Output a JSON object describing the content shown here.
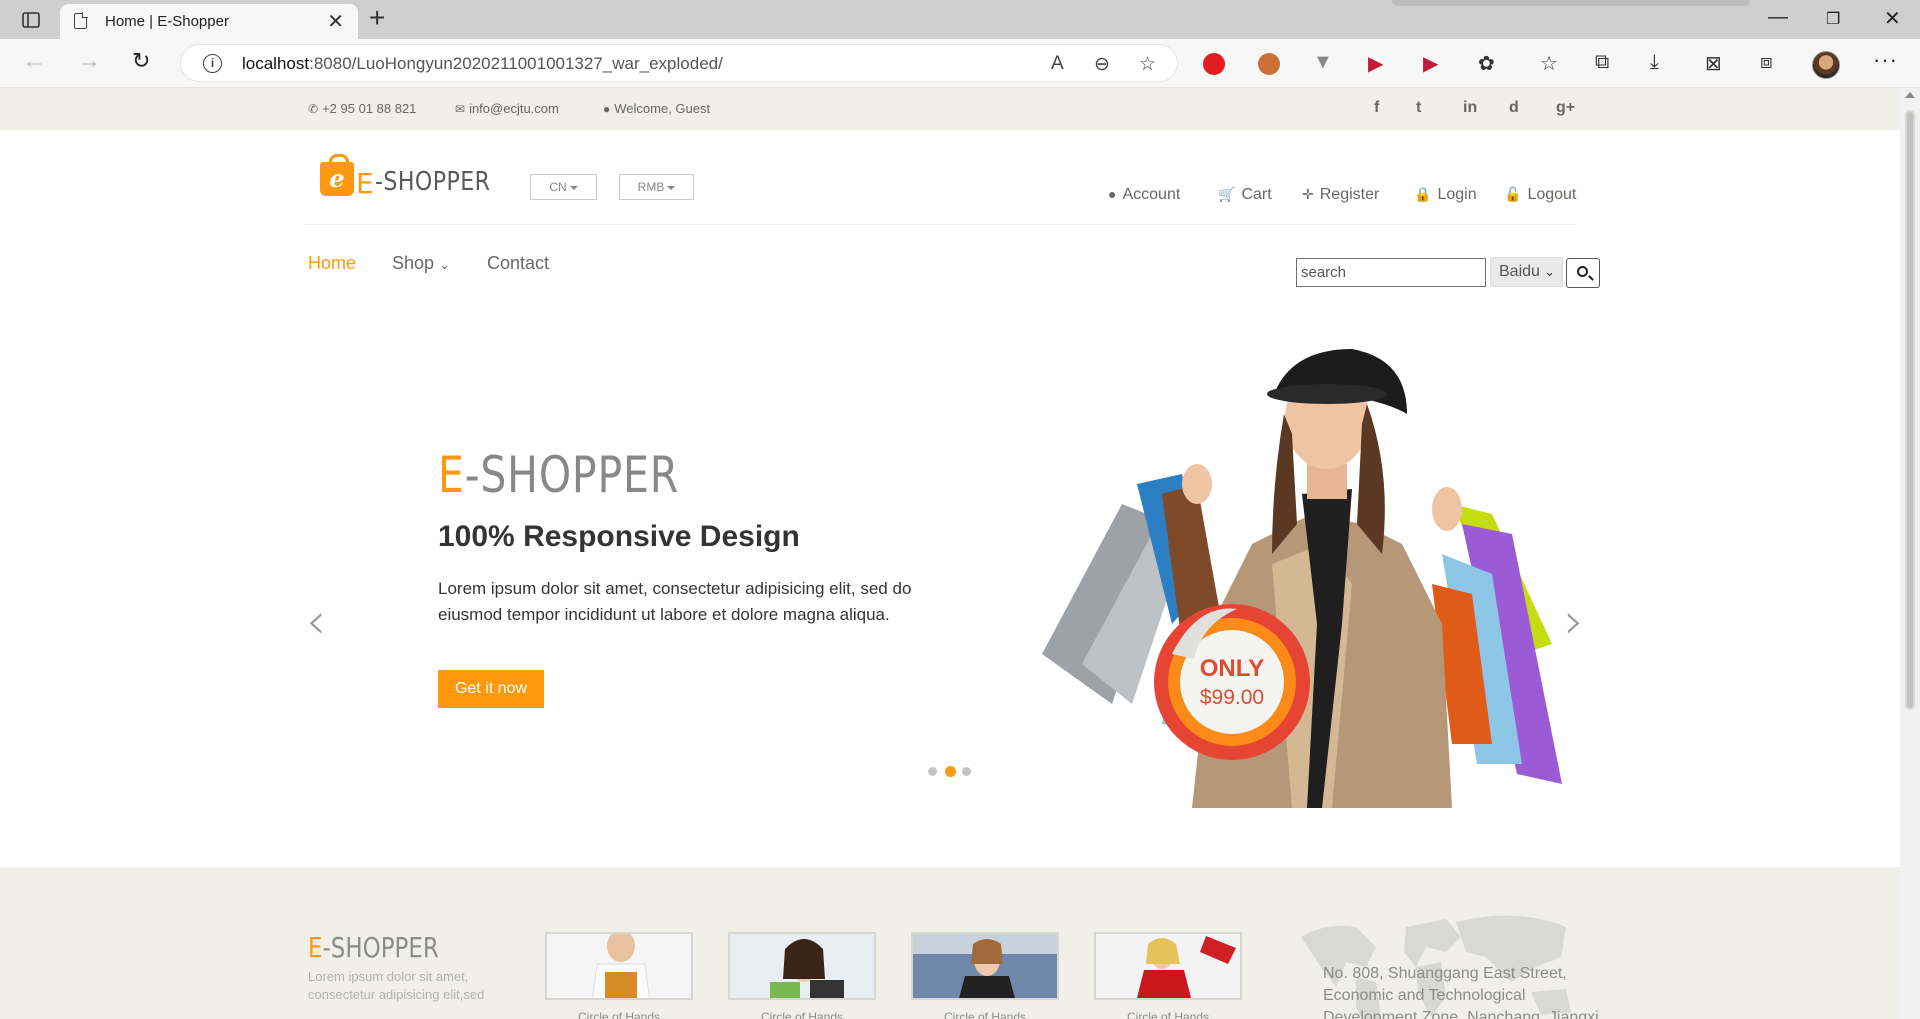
{
  "browser": {
    "tab_title": "Home | E-Shopper",
    "url_host": "localhost",
    "url_rest": ":8080/LuoHongyun2020211001001327_war_exploded/"
  },
  "topbar": {
    "phone": "+2 95 01 88 821",
    "email": "info@ecjtu.com",
    "welcome": "Welcome, Guest",
    "social": [
      "f",
      "t",
      "in",
      "d",
      "g+"
    ]
  },
  "header": {
    "logo_e": "E",
    "logo_text": "-SHOPPER",
    "lang": "CN",
    "currency": "RMB",
    "account": "Account",
    "cart": "Cart",
    "register": "Register",
    "login": "Login",
    "logout": "Logout"
  },
  "menu": {
    "home": "Home",
    "shop": "Shop",
    "contact": "Contact"
  },
  "search": {
    "placeholder": "search",
    "engine": "Baidu"
  },
  "slider": {
    "brand_e": "E",
    "brand_rest": "-SHOPPER",
    "title": "100% Responsive Design",
    "text": "Lorem ipsum dolor sit amet, consectetur adipisicing elit, sed do eiusmod tempor incididunt ut labore et dolore magna aliqua.",
    "button": "Get it now",
    "badge_only": "ONLY",
    "badge_price": "$99.00",
    "active_slide": 2,
    "slide_count": 3
  },
  "footer": {
    "brand_e": "E",
    "brand_rest": "-SHOPPER",
    "desc": "Lorem ipsum dolor sit amet, consectetur adipisicing elit,sed",
    "thumb_caption": "Circle of Hands",
    "address": "No. 808, Shuanggang East Street, Economic and Technological Development Zone, Nanchang, Jiangxi"
  },
  "colors": {
    "accent": "#fe980f",
    "topbar_bg": "#f0f0e9",
    "text": "#696763"
  }
}
